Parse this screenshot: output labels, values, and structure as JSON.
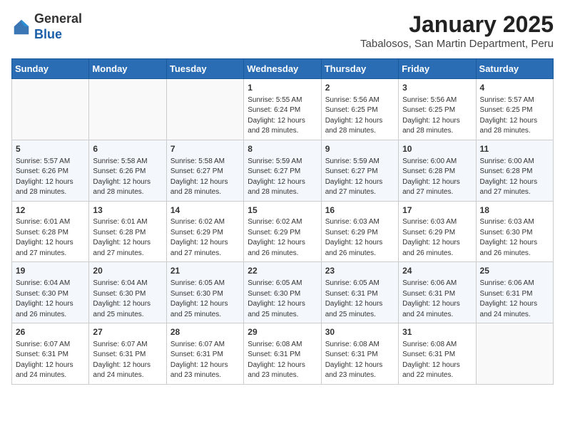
{
  "logo": {
    "general": "General",
    "blue": "Blue"
  },
  "header": {
    "title": "January 2025",
    "subtitle": "Tabalosos, San Martin Department, Peru"
  },
  "weekdays": [
    "Sunday",
    "Monday",
    "Tuesday",
    "Wednesday",
    "Thursday",
    "Friday",
    "Saturday"
  ],
  "weeks": [
    [
      {
        "day": "",
        "info": ""
      },
      {
        "day": "",
        "info": ""
      },
      {
        "day": "",
        "info": ""
      },
      {
        "day": "1",
        "info": "Sunrise: 5:55 AM\nSunset: 6:24 PM\nDaylight: 12 hours\nand 28 minutes."
      },
      {
        "day": "2",
        "info": "Sunrise: 5:56 AM\nSunset: 6:25 PM\nDaylight: 12 hours\nand 28 minutes."
      },
      {
        "day": "3",
        "info": "Sunrise: 5:56 AM\nSunset: 6:25 PM\nDaylight: 12 hours\nand 28 minutes."
      },
      {
        "day": "4",
        "info": "Sunrise: 5:57 AM\nSunset: 6:25 PM\nDaylight: 12 hours\nand 28 minutes."
      }
    ],
    [
      {
        "day": "5",
        "info": "Sunrise: 5:57 AM\nSunset: 6:26 PM\nDaylight: 12 hours\nand 28 minutes."
      },
      {
        "day": "6",
        "info": "Sunrise: 5:58 AM\nSunset: 6:26 PM\nDaylight: 12 hours\nand 28 minutes."
      },
      {
        "day": "7",
        "info": "Sunrise: 5:58 AM\nSunset: 6:27 PM\nDaylight: 12 hours\nand 28 minutes."
      },
      {
        "day": "8",
        "info": "Sunrise: 5:59 AM\nSunset: 6:27 PM\nDaylight: 12 hours\nand 28 minutes."
      },
      {
        "day": "9",
        "info": "Sunrise: 5:59 AM\nSunset: 6:27 PM\nDaylight: 12 hours\nand 27 minutes."
      },
      {
        "day": "10",
        "info": "Sunrise: 6:00 AM\nSunset: 6:28 PM\nDaylight: 12 hours\nand 27 minutes."
      },
      {
        "day": "11",
        "info": "Sunrise: 6:00 AM\nSunset: 6:28 PM\nDaylight: 12 hours\nand 27 minutes."
      }
    ],
    [
      {
        "day": "12",
        "info": "Sunrise: 6:01 AM\nSunset: 6:28 PM\nDaylight: 12 hours\nand 27 minutes."
      },
      {
        "day": "13",
        "info": "Sunrise: 6:01 AM\nSunset: 6:28 PM\nDaylight: 12 hours\nand 27 minutes."
      },
      {
        "day": "14",
        "info": "Sunrise: 6:02 AM\nSunset: 6:29 PM\nDaylight: 12 hours\nand 27 minutes."
      },
      {
        "day": "15",
        "info": "Sunrise: 6:02 AM\nSunset: 6:29 PM\nDaylight: 12 hours\nand 26 minutes."
      },
      {
        "day": "16",
        "info": "Sunrise: 6:03 AM\nSunset: 6:29 PM\nDaylight: 12 hours\nand 26 minutes."
      },
      {
        "day": "17",
        "info": "Sunrise: 6:03 AM\nSunset: 6:29 PM\nDaylight: 12 hours\nand 26 minutes."
      },
      {
        "day": "18",
        "info": "Sunrise: 6:03 AM\nSunset: 6:30 PM\nDaylight: 12 hours\nand 26 minutes."
      }
    ],
    [
      {
        "day": "19",
        "info": "Sunrise: 6:04 AM\nSunset: 6:30 PM\nDaylight: 12 hours\nand 26 minutes."
      },
      {
        "day": "20",
        "info": "Sunrise: 6:04 AM\nSunset: 6:30 PM\nDaylight: 12 hours\nand 25 minutes."
      },
      {
        "day": "21",
        "info": "Sunrise: 6:05 AM\nSunset: 6:30 PM\nDaylight: 12 hours\nand 25 minutes."
      },
      {
        "day": "22",
        "info": "Sunrise: 6:05 AM\nSunset: 6:30 PM\nDaylight: 12 hours\nand 25 minutes."
      },
      {
        "day": "23",
        "info": "Sunrise: 6:05 AM\nSunset: 6:31 PM\nDaylight: 12 hours\nand 25 minutes."
      },
      {
        "day": "24",
        "info": "Sunrise: 6:06 AM\nSunset: 6:31 PM\nDaylight: 12 hours\nand 24 minutes."
      },
      {
        "day": "25",
        "info": "Sunrise: 6:06 AM\nSunset: 6:31 PM\nDaylight: 12 hours\nand 24 minutes."
      }
    ],
    [
      {
        "day": "26",
        "info": "Sunrise: 6:07 AM\nSunset: 6:31 PM\nDaylight: 12 hours\nand 24 minutes."
      },
      {
        "day": "27",
        "info": "Sunrise: 6:07 AM\nSunset: 6:31 PM\nDaylight: 12 hours\nand 24 minutes."
      },
      {
        "day": "28",
        "info": "Sunrise: 6:07 AM\nSunset: 6:31 PM\nDaylight: 12 hours\nand 23 minutes."
      },
      {
        "day": "29",
        "info": "Sunrise: 6:08 AM\nSunset: 6:31 PM\nDaylight: 12 hours\nand 23 minutes."
      },
      {
        "day": "30",
        "info": "Sunrise: 6:08 AM\nSunset: 6:31 PM\nDaylight: 12 hours\nand 23 minutes."
      },
      {
        "day": "31",
        "info": "Sunrise: 6:08 AM\nSunset: 6:31 PM\nDaylight: 12 hours\nand 22 minutes."
      },
      {
        "day": "",
        "info": ""
      }
    ]
  ]
}
